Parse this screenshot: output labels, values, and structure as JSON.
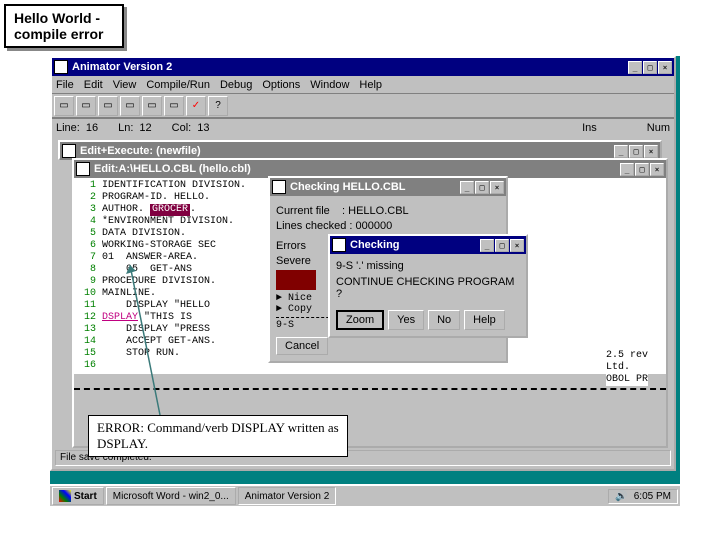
{
  "annotations": {
    "top": "Hello World - compile error",
    "bottom": "ERROR: Command/verb DISPLAY written as DSPLAY."
  },
  "main_window": {
    "title": "Animator Version 2",
    "menu": [
      "File",
      "Edit",
      "View",
      "Compile/Run",
      "Debug",
      "Options",
      "Window",
      "Help"
    ],
    "status": {
      "line_label": "Line:",
      "line": "16",
      "ln_label": "Ln:",
      "ln": "12",
      "col_label": "Col:",
      "col": "13",
      "ins": "Ins",
      "num": "Num"
    }
  },
  "edit_window": {
    "title": "Edit+Execute: (newfile)"
  },
  "code_window": {
    "title": "Edit:A:\\HELLO.CBL (hello.cbl)",
    "lines": [
      {
        "n": "1",
        "t": "IDENTIFICATION DIVISION."
      },
      {
        "n": "2",
        "t": "PROGRAM-ID. HELLO."
      },
      {
        "n": "3",
        "pre": "AUTHOR. ",
        "hl": "GROCER",
        "post": "."
      },
      {
        "n": "4",
        "t": "*ENVIRONMENT DIVISION."
      },
      {
        "n": "5",
        "t": "DATA DIVISION."
      },
      {
        "n": "6",
        "t": "WORKING-STORAGE SEC"
      },
      {
        "n": "7",
        "t": "01  ANSWER-AREA."
      },
      {
        "n": "8",
        "t": "    05  GET-ANS"
      },
      {
        "n": "9",
        "t": "PROCEDURE DIVISION."
      },
      {
        "n": "10",
        "t": "MAINLINE."
      },
      {
        "n": "11",
        "t": "    DISPLAY \"HELLO"
      },
      {
        "n": "12",
        "pre": "    ",
        "err": "DSPLAY",
        "post": " \"THIS IS"
      },
      {
        "n": "13",
        "t": "    DISPLAY \"PRESS"
      },
      {
        "n": "14",
        "t": "    ACCEPT GET-ANS."
      },
      {
        "n": "15",
        "t": "    STOP RUN."
      },
      {
        "n": "16",
        "t": ""
      }
    ],
    "fragment_right": [
      "2.5 rev",
      "Ltd.",
      "OBOL PR"
    ]
  },
  "checking_dialog": {
    "title": "Checking HELLO.CBL",
    "current_file_label": "Current file",
    "current_file": ": HELLO.CBL",
    "lines_checked_label": "Lines checked",
    "lines_checked": ": 000000",
    "errors_label": "Errors",
    "severe_label": "Severe",
    "nice": "► Nice",
    "copy": "► Copy",
    "nine_s": "9-S",
    "cancel": "Cancel"
  },
  "inner_dialog": {
    "title": "Checking",
    "msg1": "9-S '.' missing",
    "msg2": "CONTINUE CHECKING PROGRAM ?",
    "buttons": {
      "zoom": "Zoom",
      "yes": "Yes",
      "no": "No",
      "help": "Help"
    }
  },
  "bottom_status": "File save completed.",
  "taskbar": {
    "start": "Start",
    "tasks": [
      "Microsoft Word - win2_0...",
      "Animator Version 2"
    ],
    "clock": "6:05 PM"
  }
}
